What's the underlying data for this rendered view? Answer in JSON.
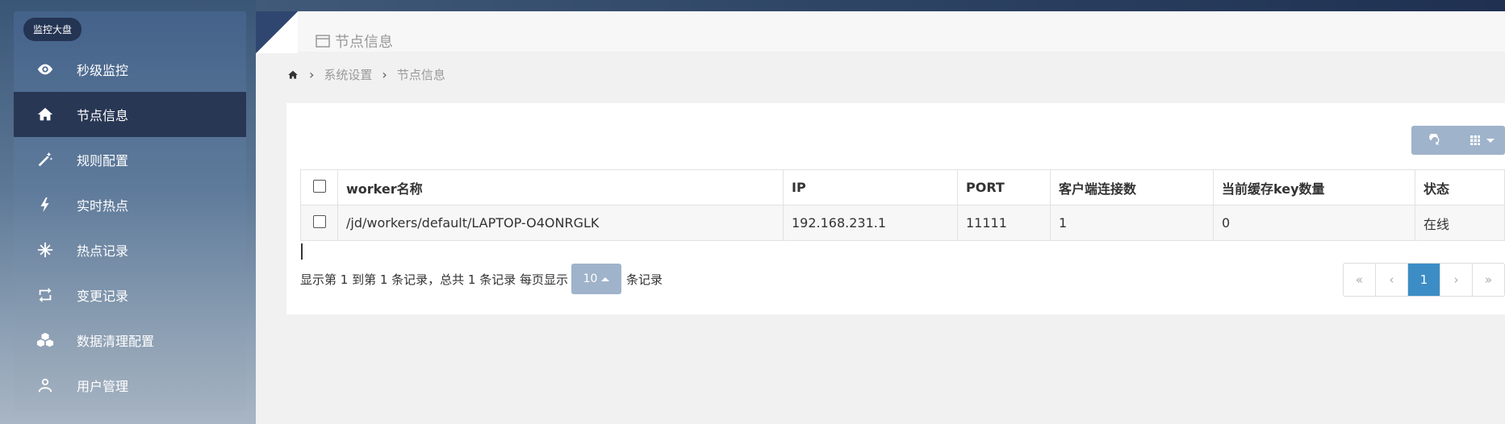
{
  "sidebar": {
    "brand": "监控大盘",
    "items": [
      {
        "label": "秒级监控",
        "icon": "eye-icon",
        "active": false
      },
      {
        "label": "节点信息",
        "icon": "home-icon",
        "active": true
      },
      {
        "label": "规则配置",
        "icon": "magic-wand-icon",
        "active": false
      },
      {
        "label": "实时热点",
        "icon": "bolt-icon",
        "active": false
      },
      {
        "label": "热点记录",
        "icon": "snowflake-icon",
        "active": false
      },
      {
        "label": "变更记录",
        "icon": "retweet-icon",
        "active": false
      },
      {
        "label": "数据清理配置",
        "icon": "cubes-icon",
        "active": false
      },
      {
        "label": "用户管理",
        "icon": "user-icon",
        "active": false
      }
    ]
  },
  "header": {
    "title": "节点信息"
  },
  "breadcrumb": {
    "items": [
      "系统设置",
      "节点信息"
    ]
  },
  "table": {
    "columns": [
      "worker名称",
      "IP",
      "PORT",
      "客户端连接数",
      "当前缓存key数量",
      "状态"
    ],
    "rows": [
      [
        "/jd/workers/default/LAPTOP-O4ONRGLK",
        "192.168.231.1",
        "11111",
        "1",
        "0",
        "在线"
      ]
    ]
  },
  "pagination": {
    "info_prefix": "显示第 1 到第 1 条记录，总共 1 条记录 每页显示",
    "page_size": "10",
    "info_suffix": "条记录",
    "first": "«",
    "prev": "‹",
    "current": "1",
    "next": "›",
    "last": "»"
  },
  "colors": {
    "accent": "#3c8dc5",
    "sidebar_active": "#283754",
    "toolbar": "#9fb3ca"
  }
}
